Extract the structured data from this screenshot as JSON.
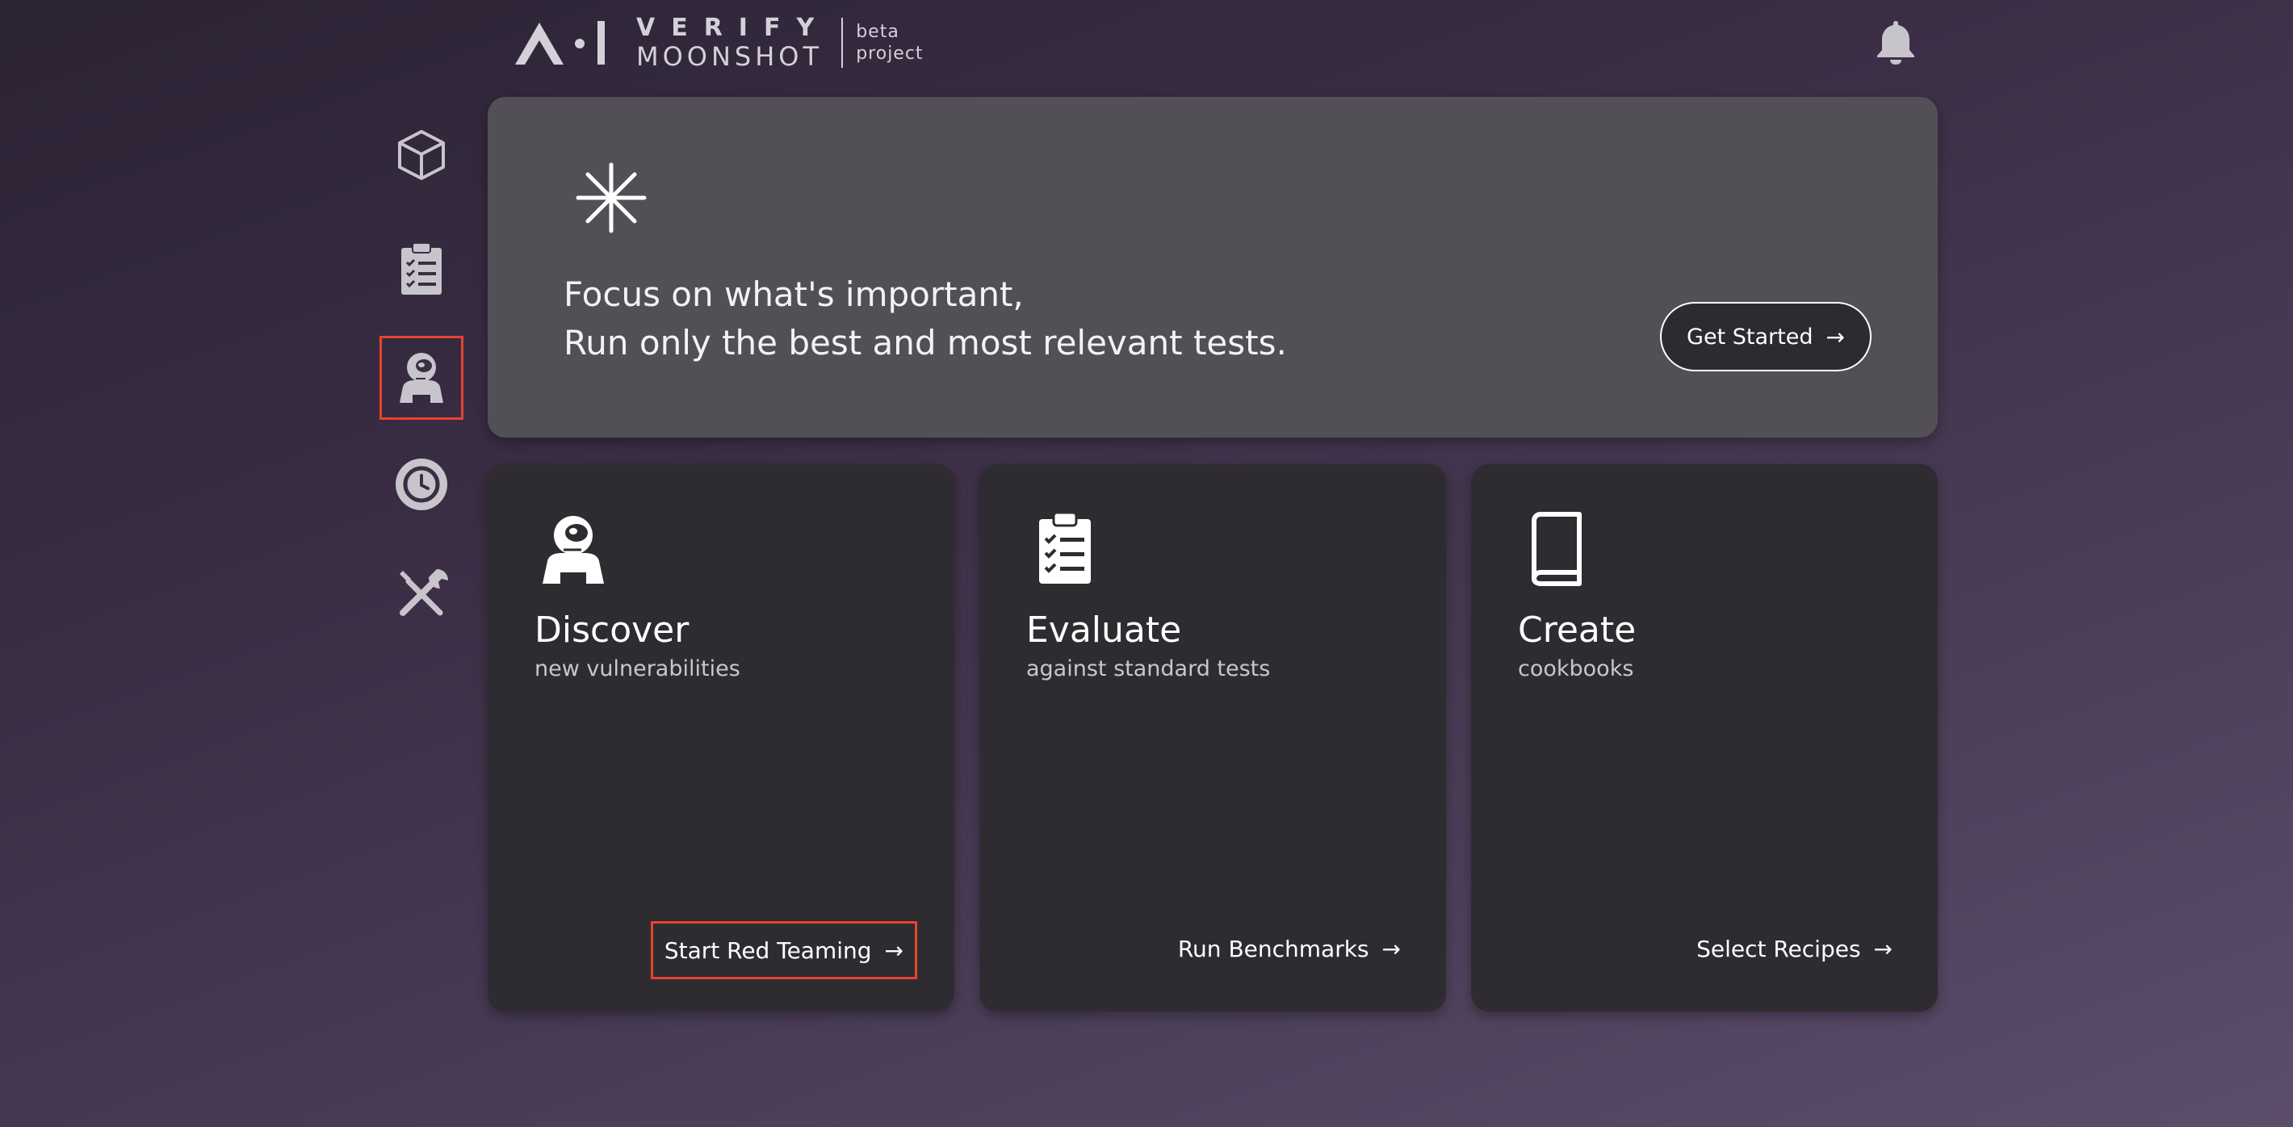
{
  "header": {
    "logo_top": "VERIFY",
    "logo_bottom": "MOONSHOT",
    "tag_line1": "beta",
    "tag_line2": "project",
    "notification_icon": "bell-icon"
  },
  "sidebar": {
    "items": [
      {
        "name": "cube-icon",
        "active": false
      },
      {
        "name": "clipboard-checklist-icon",
        "active": false
      },
      {
        "name": "astronaut-icon",
        "active": true
      },
      {
        "name": "history-icon",
        "active": false
      },
      {
        "name": "tools-icon",
        "active": false
      }
    ]
  },
  "banner": {
    "icon": "asterisk-icon",
    "line1": "Focus on what's important,",
    "line2": "Run only the best and most relevant tests.",
    "button_label": "Get Started",
    "arrow": "→"
  },
  "cards": [
    {
      "icon": "astronaut-icon",
      "title": "Discover",
      "subtitle": "new vulnerabilities",
      "action": "Start Red Teaming",
      "arrow": "→"
    },
    {
      "icon": "clipboard-checklist-icon",
      "title": "Evaluate",
      "subtitle": "against standard tests",
      "action": "Run Benchmarks",
      "arrow": "→"
    },
    {
      "icon": "book-icon",
      "title": "Create",
      "subtitle": "cookbooks",
      "action": "Select Recipes",
      "arrow": "→"
    }
  ],
  "colors": {
    "highlight": "#e8432e",
    "banner_bg": "#525056",
    "card_bg": "#2e2c31",
    "icon_gray": "#c8c4cc"
  }
}
